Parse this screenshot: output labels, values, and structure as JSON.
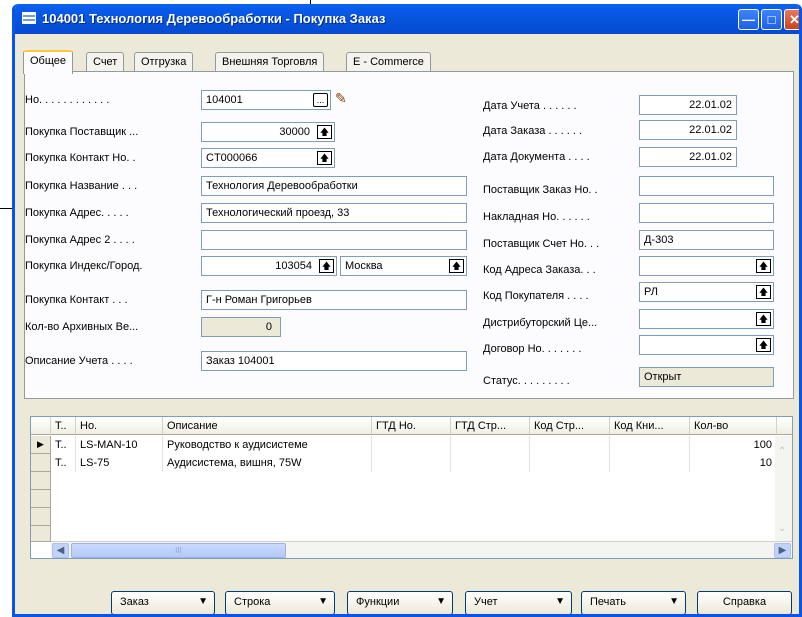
{
  "window": {
    "title": "104001 Технология Деревообработки - Покупка Заказ",
    "icon": "form-icon"
  },
  "tabs": [
    "Общее",
    "Счет",
    "Отгрузка",
    "Внешняя Торговля",
    "E - Commerce"
  ],
  "left_fields": [
    {
      "label": "Но. . . . . . . . . . . .",
      "value": "104001"
    },
    {
      "label": "Покупка Поставщик ...",
      "value": "30000"
    },
    {
      "label": "Покупка Контакт Но. .",
      "value": "CT000066"
    },
    {
      "label": "Покупка Название . . .",
      "value": "Технология Деревообработки"
    },
    {
      "label": "Покупка Адрес. . . . .",
      "value": "Технологический проезд, 33"
    },
    {
      "label": "Покупка Адрес 2 . . . .",
      "value": ""
    },
    {
      "label": "Покупка Индекс/Город.",
      "value": "103054",
      "value2": "Москва"
    },
    {
      "label": "Покупка Контакт . . .",
      "value": "Г-н Роман Григорьев"
    },
    {
      "label": "Кол-во Архивных Ве...",
      "value": "0"
    },
    {
      "label": "Описание Учета . . . .",
      "value": "Заказ 104001"
    }
  ],
  "right_fields": [
    {
      "label": "Дата Учета . . . . . .",
      "value": "22.01.02"
    },
    {
      "label": "Дата Заказа . . . . . .",
      "value": "22.01.02"
    },
    {
      "label": "Дата Документа . . . .",
      "value": "22.01.02"
    },
    {
      "label": "Поставщик Заказ Но. .",
      "value": ""
    },
    {
      "label": "Накладная Но. . . . . .",
      "value": ""
    },
    {
      "label": "Поставщик Счет Но. . .",
      "value": "Д-303"
    },
    {
      "label": "Код Адреса Заказа. . .",
      "value": ""
    },
    {
      "label": "Код Покупателя . . . .",
      "value": "РЛ"
    },
    {
      "label": "Дистрибуторский Це...",
      "value": ""
    },
    {
      "label": "Договор Но. . . . . . .",
      "value": ""
    },
    {
      "label": "Статус. . . . . . . . .",
      "value": "Открыт"
    }
  ],
  "grid": {
    "columns": [
      "Т..",
      "Но.",
      "Описание",
      "ГТД Но.",
      "ГТД Стр...",
      "Код Стр...",
      "Код Кни...",
      "Кол-во"
    ],
    "rows": [
      {
        "t": "Т..",
        "no": "LS-MAN-10",
        "desc": "Руководство к аудисистеме",
        "qty": "100"
      },
      {
        "t": "Т..",
        "no": "LS-75",
        "desc": "Аудисистема, вишня, 75W",
        "qty": "10"
      }
    ],
    "scroll_thumb": "III"
  },
  "buttons": [
    {
      "label": "Заказ"
    },
    {
      "label": "Строка"
    },
    {
      "label": "Функции"
    },
    {
      "label": "Учет"
    },
    {
      "label": "Печать"
    },
    {
      "label": "Справка"
    }
  ]
}
